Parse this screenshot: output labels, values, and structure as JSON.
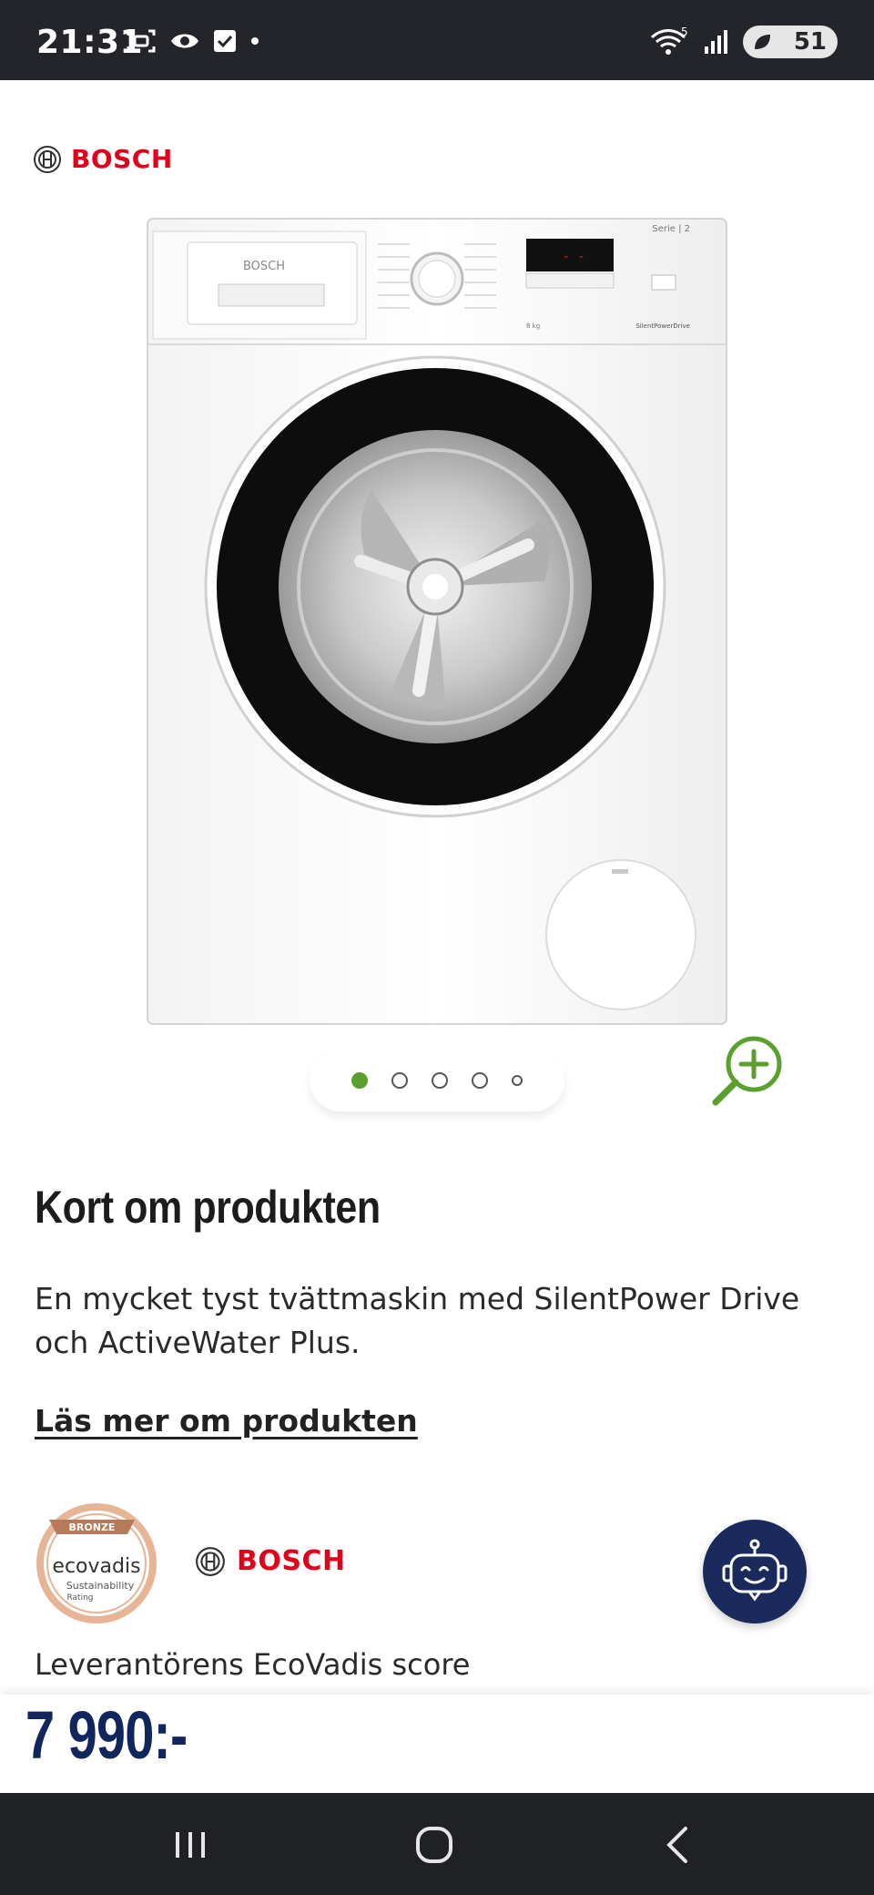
{
  "status_bar": {
    "time": "21:31",
    "battery": "51",
    "wifi_label": "5"
  },
  "brand": {
    "name": "BOSCH",
    "color": "#e2001a"
  },
  "gallery": {
    "total_images": 5,
    "active_index": 0,
    "accent": "#5aa02c",
    "zoom_icon": "zoom-in-icon"
  },
  "machine_panel": {
    "serie": "Serie | 2",
    "drive": "SilentPowerDrive",
    "capacity": "8 kg",
    "drawer_brand": "BOSCH"
  },
  "product": {
    "section_title": "Kort om produkten",
    "description": "En mycket tyst tvättmaskin med SilentPower Drive och ActiveWater Plus.",
    "read_more": "Läs mer om produkten"
  },
  "sustainability": {
    "badge_level": "BRONZE",
    "badge_name": "ecovadis",
    "badge_sub1": "Sustainability",
    "badge_sub2": "Rating",
    "label": "Leverantörens EcoVadis score"
  },
  "price": {
    "value": "7 990:-",
    "color": "#12265e"
  },
  "assistant": {
    "icon": "chatbot-icon",
    "color": "#1b2a5c"
  },
  "nav": {
    "recents": "recents-icon",
    "home": "home-icon",
    "back": "back-icon"
  }
}
